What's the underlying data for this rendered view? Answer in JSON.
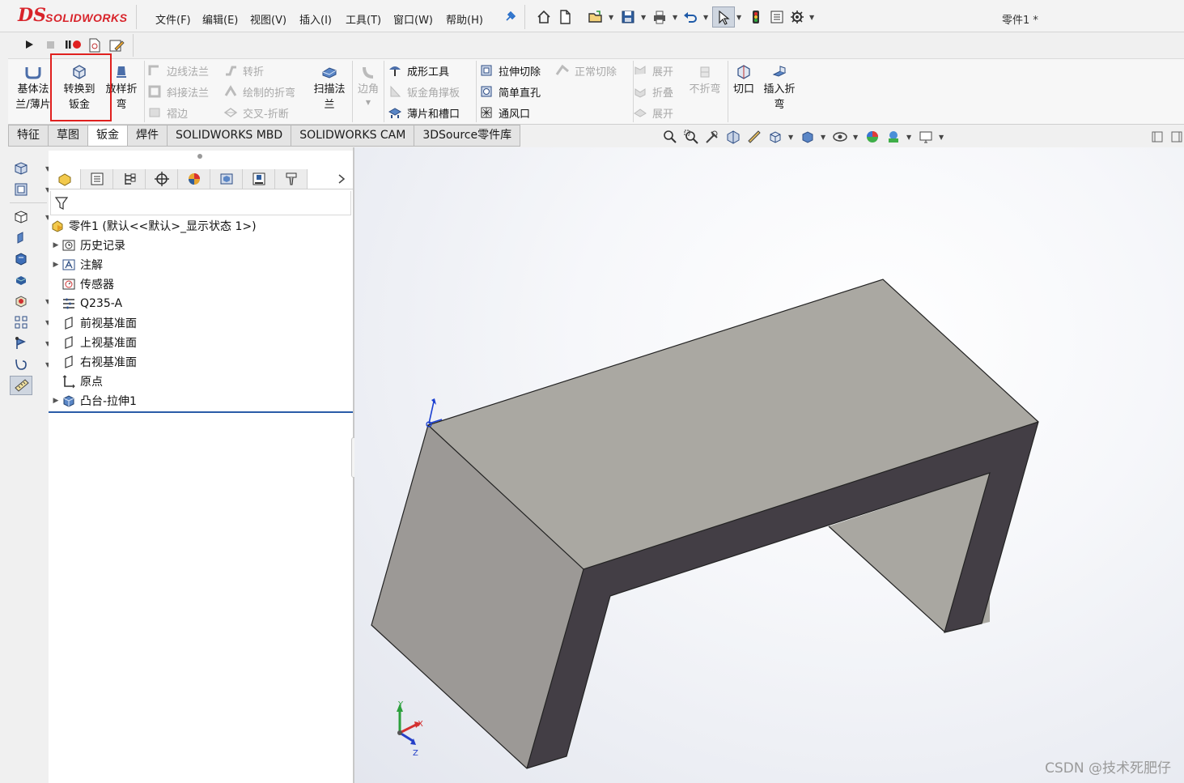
{
  "app": {
    "logo_prefix": "DS",
    "logo_name": "SOLIDWORKS",
    "document_title": "零件1 *"
  },
  "menu": [
    "文件(F)",
    "编辑(E)",
    "视图(V)",
    "插入(I)",
    "工具(T)",
    "窗口(W)",
    "帮助(H)"
  ],
  "command_manager": {
    "base_flange": [
      "基体法",
      "兰/薄片"
    ],
    "convert_to_sheet_metal": [
      "转换到",
      "钣金"
    ],
    "lofted_bend": [
      "放样折",
      "弯"
    ],
    "edge_flange": "边线法兰",
    "miter_flange": "斜接法兰",
    "hem": "褶边",
    "jog": "转折",
    "sketched_bend": "绘制的折弯",
    "cross_break": "交叉-折断",
    "swept_flange": [
      "扫描法",
      "兰"
    ],
    "corners": "边角",
    "forming_tool": "成形工具",
    "sheet_metal_gusset": "钣金角撑板",
    "tab_and_slot": "薄片和槽口",
    "extruded_cut": "拉伸切除",
    "normal_cut": "正常切除",
    "simple_hole": "简单直孔",
    "vent": "通风口",
    "unfold": "展开",
    "fold": "折叠",
    "flatten": "展开",
    "no_bends": "不折弯",
    "rip": "切口",
    "insert_bends": [
      "插入折",
      "弯"
    ]
  },
  "tabs": [
    {
      "label": "特征",
      "active": false
    },
    {
      "label": "草图",
      "active": false
    },
    {
      "label": "钣金",
      "active": true
    },
    {
      "label": "焊件",
      "active": false
    },
    {
      "label": "SOLIDWORKS MBD",
      "active": false
    },
    {
      "label": "SOLIDWORKS CAM",
      "active": false
    },
    {
      "label": "3DSource零件库",
      "active": false
    }
  ],
  "tree": {
    "root": "零件1  (默认<<默认>_显示状态 1>)",
    "items": [
      {
        "label": "历史记录",
        "expandable": true,
        "icon": "history-icon"
      },
      {
        "label": "注解",
        "expandable": true,
        "icon": "annotations-icon"
      },
      {
        "label": "传感器",
        "expandable": false,
        "icon": "sensor-icon"
      },
      {
        "label": "Q235-A",
        "expandable": false,
        "icon": "material-icon"
      },
      {
        "label": "前视基准面",
        "expandable": false,
        "icon": "plane-icon"
      },
      {
        "label": "上视基准面",
        "expandable": false,
        "icon": "plane-icon"
      },
      {
        "label": "右视基准面",
        "expandable": false,
        "icon": "plane-icon"
      },
      {
        "label": "原点",
        "expandable": false,
        "icon": "origin-icon"
      },
      {
        "label": "凸台-拉伸1",
        "expandable": true,
        "icon": "extrude-icon"
      }
    ]
  },
  "triad": {
    "x": "X",
    "y": "Y",
    "z": "Z"
  },
  "watermark": "CSDN @技术死肥仔",
  "colors": {
    "highlight_box": "#e0201e",
    "model_top": "#aaa8a2",
    "model_left": "#9c9996",
    "model_front_dark": "#433e45",
    "model_inner": "#a9a7a1",
    "brand_red": "#d8232a"
  }
}
